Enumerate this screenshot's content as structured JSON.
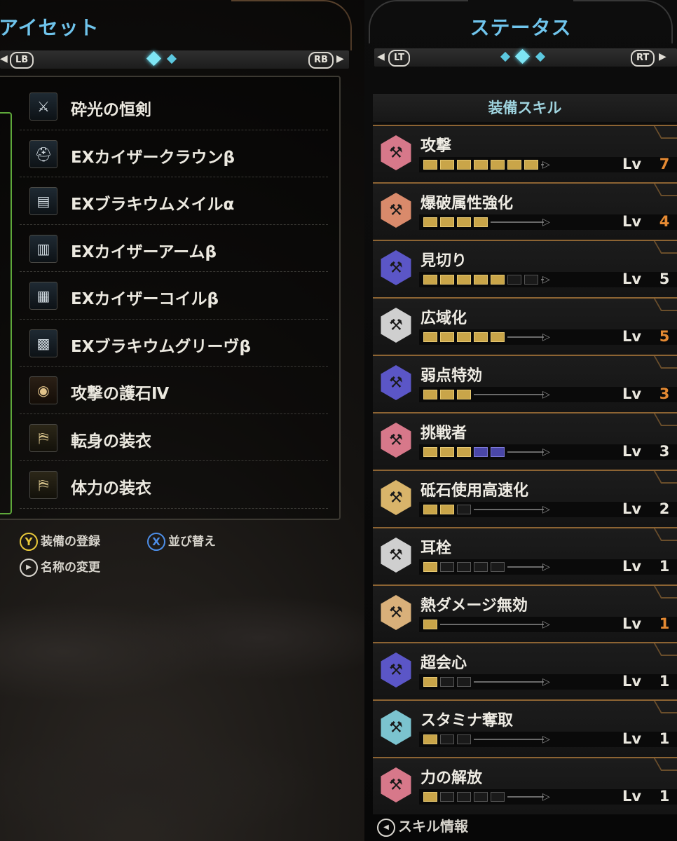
{
  "left": {
    "title": "アイセット",
    "nav_left": "LB",
    "nav_right": "RB",
    "equipment": [
      {
        "name": "砕光の恒剣",
        "icon": "sword-icon",
        "glyph": "⚔",
        "kind": "weapon"
      },
      {
        "name": "EXカイザークラウンβ",
        "icon": "helmet-icon",
        "glyph": "⛑",
        "kind": "armor"
      },
      {
        "name": "EXブラキウムメイルα",
        "icon": "chest-armor-icon",
        "glyph": "▤",
        "kind": "armor"
      },
      {
        "name": "EXカイザーアームβ",
        "icon": "gauntlet-icon",
        "glyph": "▥",
        "kind": "armor"
      },
      {
        "name": "EXカイザーコイルβ",
        "icon": "waist-armor-icon",
        "glyph": "▦",
        "kind": "armor"
      },
      {
        "name": "EXブラキウムグリーヴβ",
        "icon": "greaves-icon",
        "glyph": "▩",
        "kind": "armor"
      },
      {
        "name": "攻撃の護石Ⅳ",
        "icon": "charm-icon",
        "glyph": "◉",
        "kind": "charm"
      },
      {
        "name": "転身の装衣",
        "icon": "mantle-icon",
        "glyph": "⛿",
        "kind": "mantle"
      },
      {
        "name": "体力の装衣",
        "icon": "mantle-icon",
        "glyph": "⛿",
        "kind": "mantle"
      }
    ],
    "hints": {
      "register_btn": "Y",
      "register_label": "装備の登録",
      "sort_btn": "X",
      "sort_label": "並び替え",
      "rename_btn": "▶",
      "rename_label": "名称の変更"
    }
  },
  "right": {
    "title": "ステータス",
    "nav_left": "LT",
    "nav_right": "RT",
    "section_header": "装備スキル",
    "skills": [
      {
        "name": "攻撃",
        "level": 7,
        "max": 7,
        "filled": 7,
        "secret": 0,
        "maxed": true,
        "color": "#d7788a"
      },
      {
        "name": "爆破属性強化",
        "level": 4,
        "max": 4,
        "filled": 4,
        "secret": 0,
        "maxed": true,
        "color": "#d98a6b"
      },
      {
        "name": "見切り",
        "level": 5,
        "max": 7,
        "filled": 5,
        "secret": 0,
        "maxed": false,
        "color": "#5b56c7"
      },
      {
        "name": "広域化",
        "level": 5,
        "max": 5,
        "filled": 5,
        "secret": 0,
        "maxed": true,
        "color": "#cfcfcf"
      },
      {
        "name": "弱点特効",
        "level": 3,
        "max": 3,
        "filled": 3,
        "secret": 0,
        "maxed": true,
        "color": "#5b56c7"
      },
      {
        "name": "挑戦者",
        "level": 3,
        "max": 5,
        "filled": 3,
        "secret": 2,
        "maxed": false,
        "color": "#d7788a"
      },
      {
        "name": "砥石使用高速化",
        "level": 2,
        "max": 3,
        "filled": 2,
        "secret": 0,
        "maxed": false,
        "color": "#d9b46a"
      },
      {
        "name": "耳栓",
        "level": 1,
        "max": 5,
        "filled": 1,
        "secret": 0,
        "maxed": false,
        "color": "#cfcfcf"
      },
      {
        "name": "熱ダメージ無効",
        "level": 1,
        "max": 1,
        "filled": 1,
        "secret": 0,
        "maxed": true,
        "color": "#d9b07a"
      },
      {
        "name": "超会心",
        "level": 1,
        "max": 3,
        "filled": 1,
        "secret": 0,
        "maxed": false,
        "color": "#5b56c7"
      },
      {
        "name": "スタミナ奪取",
        "level": 1,
        "max": 3,
        "filled": 1,
        "secret": 0,
        "maxed": false,
        "color": "#7bc3cf"
      },
      {
        "name": "力の解放",
        "level": 1,
        "max": 5,
        "filled": 1,
        "secret": 0,
        "maxed": false,
        "color": "#d7788a"
      }
    ],
    "lv_label": "Lv",
    "lv_color_normal": "#e9e6dd",
    "lv_color_max": "#e58a33",
    "skill_info_label": "スキル情報",
    "skill_info_btn": "◀"
  }
}
